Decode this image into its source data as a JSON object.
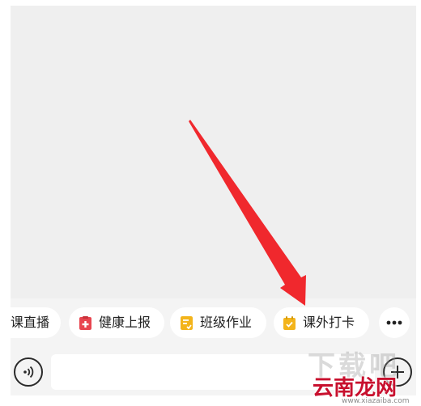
{
  "quick_actions": [
    {
      "label": "课直播",
      "icon": "",
      "icon_color": ""
    },
    {
      "label": "健康上报",
      "icon": "health-report-icon",
      "icon_color": "#e8454f"
    },
    {
      "label": "班级作业",
      "icon": "homework-icon",
      "icon_color": "#f3b41b"
    },
    {
      "label": "课外打卡",
      "icon": "checkin-calendar-icon",
      "icon_color": "#f3b41b"
    }
  ],
  "more_button": {
    "icon": "more-dots-icon"
  },
  "input_bar": {
    "voice_icon": "voice-icon",
    "message_value": "",
    "plus_icon": "plus-icon"
  },
  "annotation": {
    "arrow_color": "#f0282d"
  },
  "watermark": {
    "large_text": "下载吧",
    "brand": "云南龙网",
    "url": "www.xiazaiba.com"
  },
  "colors": {
    "chat_background": "#efefef",
    "bar_background": "#f4f4f4",
    "chip_background": "#ffffff",
    "text": "#222222"
  }
}
